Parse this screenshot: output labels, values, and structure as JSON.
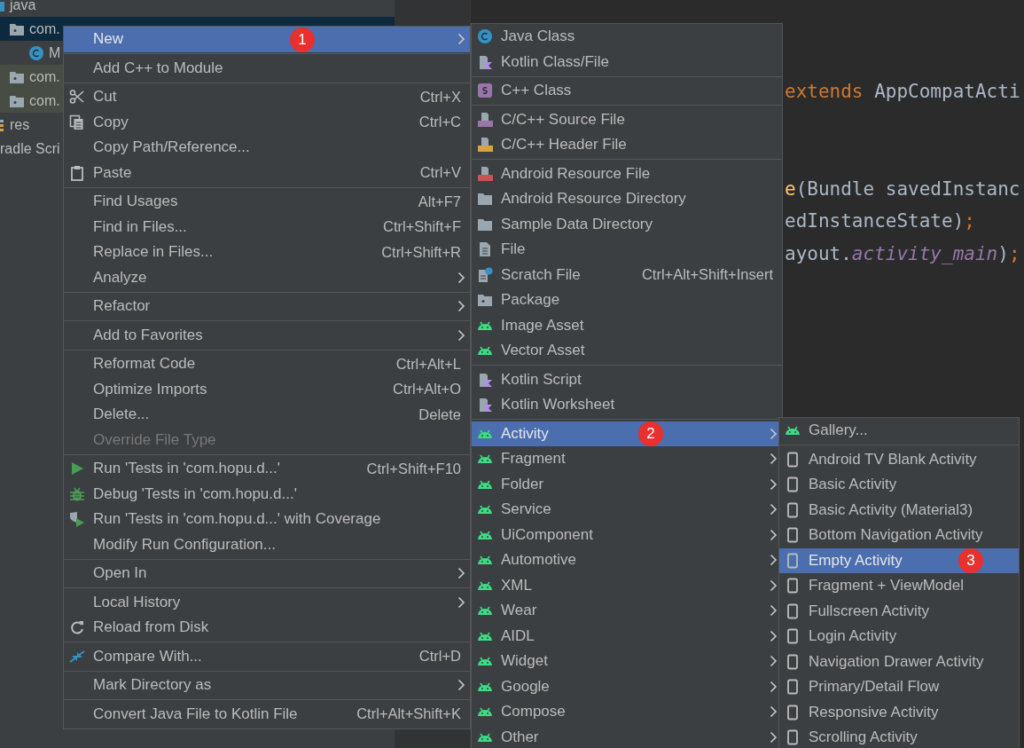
{
  "project_tree": [
    {
      "label": "java",
      "kind": "source-folder",
      "selected": false,
      "tinted": false,
      "children": [
        {
          "label": "com.",
          "kind": "package",
          "selected": true,
          "tinted": false,
          "children": [
            {
              "label": "M",
              "kind": "class",
              "selected": false,
              "tinted": false
            }
          ]
        },
        {
          "label": "com.",
          "kind": "package",
          "selected": false,
          "tinted": true
        },
        {
          "label": "com.",
          "kind": "package",
          "selected": false,
          "tinted": true
        }
      ]
    },
    {
      "label": "res",
      "kind": "resources",
      "selected": false,
      "tinted": false
    },
    {
      "label": "radle Scri",
      "selected": false,
      "tinted": false
    }
  ],
  "editor": {
    "lines": [
      [
        {
          "text": "extends",
          "kind": "keyword"
        },
        {
          "text": " AppCompatActi",
          "kind": "plain"
        }
      ],
      [
        {
          "text": "e",
          "kind": "method"
        },
        {
          "text": "(Bundle savedInstanc",
          "kind": "plain"
        }
      ],
      [
        {
          "text": "edInstanceState)",
          "kind": "plain"
        },
        {
          "text": ";",
          "kind": "keyword"
        }
      ],
      [
        {
          "text": "ayout.",
          "kind": "plain"
        },
        {
          "text": "activity_main",
          "kind": "field"
        },
        {
          "text": ")",
          "kind": "plain"
        },
        {
          "text": ";",
          "kind": "keyword"
        }
      ]
    ]
  },
  "context_menu": {
    "groups": [
      {
        "items": [
          {
            "label": "New",
            "selected": true,
            "disabled": false,
            "submenu": true,
            "badge": "1"
          }
        ]
      },
      {
        "items": [
          {
            "label": "Add C++ to Module",
            "selected": false,
            "disabled": false,
            "submenu": false
          }
        ]
      },
      {
        "items": [
          {
            "label": "Cut",
            "kind": "scissors",
            "shortcut": "Ctrl+X",
            "selected": false,
            "disabled": false,
            "submenu": false
          },
          {
            "label": "Copy",
            "kind": "copy",
            "shortcut": "Ctrl+C",
            "selected": false,
            "disabled": false,
            "submenu": false
          },
          {
            "label": "Copy Path/Reference...",
            "selected": false,
            "disabled": false,
            "submenu": false
          },
          {
            "label": "Paste",
            "kind": "clipboard",
            "shortcut": "Ctrl+V",
            "selected": false,
            "disabled": false,
            "submenu": false
          }
        ]
      },
      {
        "items": [
          {
            "label": "Find Usages",
            "shortcut": "Alt+F7",
            "selected": false,
            "disabled": false,
            "submenu": false
          },
          {
            "label": "Find in Files...",
            "shortcut": "Ctrl+Shift+F",
            "selected": false,
            "disabled": false,
            "submenu": false
          },
          {
            "label": "Replace in Files...",
            "shortcut": "Ctrl+Shift+R",
            "selected": false,
            "disabled": false,
            "submenu": false
          },
          {
            "label": "Analyze",
            "selected": false,
            "disabled": false,
            "submenu": true
          }
        ]
      },
      {
        "items": [
          {
            "label": "Refactor",
            "selected": false,
            "disabled": false,
            "submenu": true
          }
        ]
      },
      {
        "items": [
          {
            "label": "Add to Favorites",
            "selected": false,
            "disabled": false,
            "submenu": true
          }
        ]
      },
      {
        "items": [
          {
            "label": "Reformat Code",
            "shortcut": "Ctrl+Alt+L",
            "selected": false,
            "disabled": false,
            "submenu": false
          },
          {
            "label": "Optimize Imports",
            "shortcut": "Ctrl+Alt+O",
            "selected": false,
            "disabled": false,
            "submenu": false
          },
          {
            "label": "Delete...",
            "shortcut": "Delete",
            "selected": false,
            "disabled": false,
            "submenu": false
          },
          {
            "label": "Override File Type",
            "selected": false,
            "disabled": true,
            "submenu": false
          }
        ]
      },
      {
        "items": [
          {
            "label": "Run 'Tests in 'com.hopu.d...'",
            "kind": "run",
            "shortcut": "Ctrl+Shift+F10",
            "selected": false,
            "disabled": false,
            "submenu": false
          },
          {
            "label": "Debug 'Tests in 'com.hopu.d...'",
            "kind": "debug",
            "selected": false,
            "disabled": false,
            "submenu": false
          },
          {
            "label": "Run 'Tests in 'com.hopu.d...' with Coverage",
            "kind": "coverage",
            "selected": false,
            "disabled": false,
            "submenu": false
          },
          {
            "label": "Modify Run Configuration...",
            "selected": false,
            "disabled": false,
            "submenu": false
          }
        ]
      },
      {
        "items": [
          {
            "label": "Open In",
            "selected": false,
            "disabled": false,
            "submenu": true
          }
        ]
      },
      {
        "items": [
          {
            "label": "Local History",
            "selected": false,
            "disabled": false,
            "submenu": true
          },
          {
            "label": "Reload from Disk",
            "kind": "reload",
            "selected": false,
            "disabled": false,
            "submenu": false
          }
        ]
      },
      {
        "items": [
          {
            "label": "Compare With...",
            "kind": "compare",
            "shortcut": "Ctrl+D",
            "selected": false,
            "disabled": false,
            "submenu": false
          }
        ]
      },
      {
        "items": [
          {
            "label": "Mark Directory as",
            "selected": false,
            "disabled": false,
            "submenu": true
          }
        ]
      },
      {
        "items": [
          {
            "label": "Convert Java File to Kotlin File",
            "shortcut": "Ctrl+Alt+Shift+K",
            "selected": false,
            "disabled": false,
            "submenu": false
          }
        ]
      }
    ]
  },
  "new_submenu": {
    "groups": [
      {
        "items": [
          {
            "label": "Java Class",
            "kind": "java-class",
            "selected": false,
            "disabled": false,
            "submenu": false
          },
          {
            "label": "Kotlin Class/File",
            "kind": "kotlin",
            "selected": false,
            "disabled": false,
            "submenu": false
          }
        ]
      },
      {
        "items": [
          {
            "label": "C++ Class",
            "kind": "cpp-class",
            "selected": false,
            "disabled": false,
            "submenu": false
          }
        ]
      },
      {
        "items": [
          {
            "label": "C/C++ Source File",
            "kind": "source-file",
            "selected": false,
            "disabled": false,
            "submenu": false
          },
          {
            "label": "C/C++ Header File",
            "kind": "header-file",
            "selected": false,
            "disabled": false,
            "submenu": false
          }
        ]
      },
      {
        "items": [
          {
            "label": "Android Resource File",
            "kind": "resource-file",
            "selected": false,
            "disabled": false,
            "submenu": false
          },
          {
            "label": "Android Resource Directory",
            "kind": "folder",
            "selected": false,
            "disabled": false,
            "submenu": false
          },
          {
            "label": "Sample Data Directory",
            "kind": "folder",
            "selected": false,
            "disabled": false,
            "submenu": false
          },
          {
            "label": "File",
            "kind": "file",
            "selected": false,
            "disabled": false,
            "submenu": false
          },
          {
            "label": "Scratch File",
            "kind": "scratch",
            "shortcut": "Ctrl+Alt+Shift+Insert",
            "selected": false,
            "disabled": false,
            "submenu": false
          },
          {
            "label": "Package",
            "kind": "package",
            "selected": false,
            "disabled": false,
            "submenu": false
          },
          {
            "label": "Image Asset",
            "kind": "android",
            "selected": false,
            "disabled": false,
            "submenu": false
          },
          {
            "label": "Vector Asset",
            "kind": "android",
            "selected": false,
            "disabled": false,
            "submenu": false
          }
        ]
      },
      {
        "items": [
          {
            "label": "Kotlin Script",
            "kind": "kotlin",
            "selected": false,
            "disabled": false,
            "submenu": false
          },
          {
            "label": "Kotlin Worksheet",
            "kind": "kotlin",
            "selected": false,
            "disabled": false,
            "submenu": false
          }
        ]
      },
      {
        "items": [
          {
            "label": "Activity",
            "kind": "android",
            "selected": true,
            "disabled": false,
            "submenu": true,
            "badge": "2"
          },
          {
            "label": "Fragment",
            "kind": "android",
            "selected": false,
            "disabled": false,
            "submenu": true
          },
          {
            "label": "Folder",
            "kind": "android",
            "selected": false,
            "disabled": false,
            "submenu": true
          },
          {
            "label": "Service",
            "kind": "android",
            "selected": false,
            "disabled": false,
            "submenu": true
          },
          {
            "label": "UiComponent",
            "kind": "android",
            "selected": false,
            "disabled": false,
            "submenu": true
          },
          {
            "label": "Automotive",
            "kind": "android",
            "selected": false,
            "disabled": false,
            "submenu": true
          },
          {
            "label": "XML",
            "kind": "android",
            "selected": false,
            "disabled": false,
            "submenu": true
          },
          {
            "label": "Wear",
            "kind": "android",
            "selected": false,
            "disabled": false,
            "submenu": true
          },
          {
            "label": "AIDL",
            "kind": "android",
            "selected": false,
            "disabled": false,
            "submenu": true
          },
          {
            "label": "Widget",
            "kind": "android",
            "selected": false,
            "disabled": false,
            "submenu": true
          },
          {
            "label": "Google",
            "kind": "android",
            "selected": false,
            "disabled": false,
            "submenu": true
          },
          {
            "label": "Compose",
            "kind": "android",
            "selected": false,
            "disabled": false,
            "submenu": true
          },
          {
            "label": "Other",
            "kind": "android",
            "selected": false,
            "disabled": false,
            "submenu": true
          }
        ]
      }
    ]
  },
  "activity_submenu": {
    "groups": [
      {
        "items": [
          {
            "label": "Gallery...",
            "kind": "android",
            "selected": false,
            "disabled": false,
            "submenu": false
          }
        ]
      },
      {
        "items": [
          {
            "label": "Android TV Blank Activity",
            "kind": "phone",
            "selected": false,
            "disabled": false,
            "submenu": false
          },
          {
            "label": "Basic Activity",
            "kind": "phone",
            "selected": false,
            "disabled": false,
            "submenu": false
          },
          {
            "label": "Basic Activity (Material3)",
            "kind": "phone",
            "selected": false,
            "disabled": false,
            "submenu": false
          },
          {
            "label": "Bottom Navigation Activity",
            "kind": "phone",
            "selected": false,
            "disabled": false,
            "submenu": false
          },
          {
            "label": "Empty Activity",
            "kind": "phone",
            "selected": true,
            "disabled": false,
            "submenu": false,
            "badge": "3"
          },
          {
            "label": "Fragment + ViewModel",
            "kind": "phone",
            "selected": false,
            "disabled": false,
            "submenu": false
          },
          {
            "label": "Fullscreen Activity",
            "kind": "phone",
            "selected": false,
            "disabled": false,
            "submenu": false
          },
          {
            "label": "Login Activity",
            "kind": "phone",
            "selected": false,
            "disabled": false,
            "submenu": false
          },
          {
            "label": "Navigation Drawer Activity",
            "kind": "phone",
            "selected": false,
            "disabled": false,
            "submenu": false
          },
          {
            "label": "Primary/Detail Flow",
            "kind": "phone",
            "selected": false,
            "disabled": false,
            "submenu": false
          },
          {
            "label": "Responsive Activity",
            "kind": "phone",
            "selected": false,
            "disabled": false,
            "submenu": false
          },
          {
            "label": "Scrolling Activity",
            "kind": "phone",
            "selected": false,
            "disabled": false,
            "submenu": false
          }
        ]
      }
    ]
  }
}
